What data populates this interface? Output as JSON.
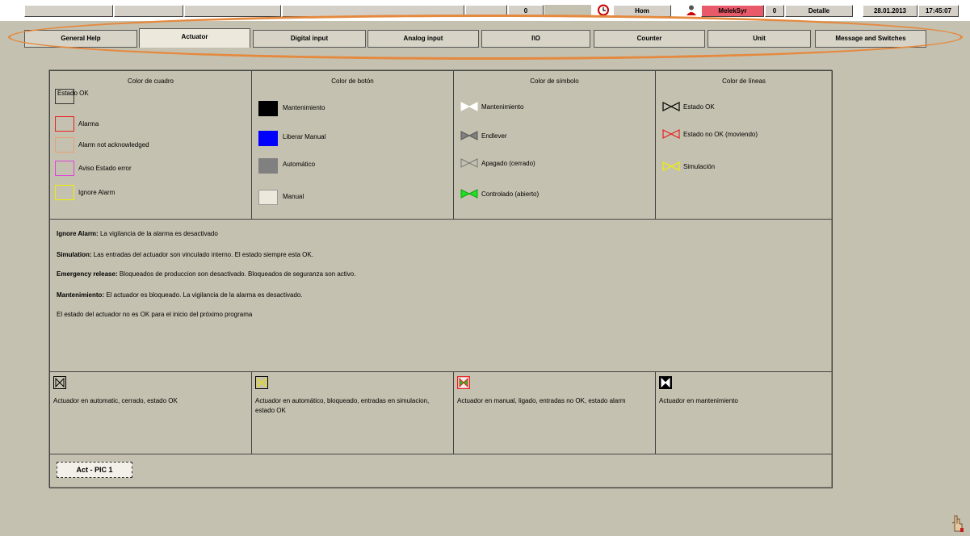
{
  "topbar": {
    "counter": "0",
    "mode_label": "Hom",
    "user": "MelekSyr",
    "user_count": "0",
    "details": "Detalle",
    "date": "28.01.2013",
    "time": "17:45:07"
  },
  "tabs": [
    "General Help",
    "Actuator",
    "Digital input",
    "Analog input",
    "I\\O",
    "Counter",
    "Unit",
    "Message and Switches"
  ],
  "legend": {
    "frame": {
      "title": "Color de cuadro",
      "items": [
        "Estado OK",
        "Alarma",
        "Alarm not acknowledged",
        "Aviso Estado error",
        "Ignore Alarm"
      ]
    },
    "button": {
      "title": "Color de botón",
      "items": [
        "Mantenimiento",
        "Liberar Manual",
        "Automático",
        "Manual"
      ]
    },
    "symbol": {
      "title": "Color de símbolo",
      "items": [
        "Mantenimiento",
        "Endlever",
        "Apagado (cerrado)",
        "Controlado (abierto)"
      ]
    },
    "lines": {
      "title": "Color de líneas",
      "items": [
        "Estado OK",
        "Estado no OK (moviendo)",
        "Simulación"
      ]
    }
  },
  "notes": [
    {
      "term": "Ignore Alarm:",
      "text": " La vigilancia de la alarma es desactivado"
    },
    {
      "term": "Simulation:",
      "text": " Las entradas del actuador son vinculado interno. El estado siempre esta OK."
    },
    {
      "term": "Emergency release:",
      "text": " Bloqueados de produccion son desactivado. Bloqueados de seguranza son activo."
    },
    {
      "term": "Mantenimiento:",
      "text": " El actuador es bloqueado. La vigilancia de la alarma es desactivado."
    },
    {
      "term": "",
      "text": "El estado del actuador no es OK para el inicio del próximo programa"
    }
  ],
  "examples": [
    "Actuador en automatic, cerrado, estado OK",
    "Actuador en automático, bloqueado, entradas en simulacion, estado OK",
    "Actuador en manual, ligado, entradas no OK, estado alarm",
    "Actuador en mantenimiento"
  ],
  "footer_button": "Act - PIC 1",
  "colors": {
    "background": "#c5c1b0",
    "alarm_red": "#e82020",
    "not_ack_orange": "#e8a070",
    "warning_magenta": "#e040e0",
    "ignore_yellow": "#f0f000",
    "manual_blue": "#0000ff",
    "open_green": "#20e020",
    "highlight_orange": "#e5893e"
  }
}
